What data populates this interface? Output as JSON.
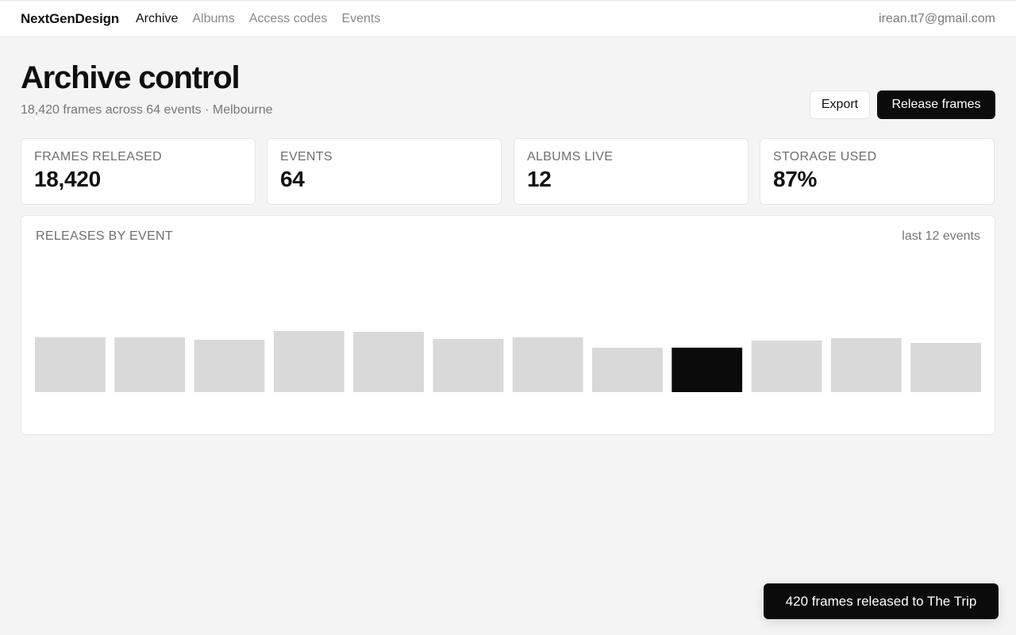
{
  "nav": {
    "brand": "NextGenDesign",
    "links": [
      {
        "label": "Archive",
        "active": true
      },
      {
        "label": "Albums",
        "active": false
      },
      {
        "label": "Access codes",
        "active": false
      },
      {
        "label": "Events",
        "active": false
      }
    ],
    "user_email": "irean.tt7@gmail.com"
  },
  "header": {
    "title": "Archive control",
    "subtitle": "18,420 frames across 64 events · Melbourne",
    "export_label": "Export",
    "release_label": "Release frames"
  },
  "stats": [
    {
      "label": "FRAMES RELEASED",
      "value": "18,420"
    },
    {
      "label": "EVENTS",
      "value": "64"
    },
    {
      "label": "ALBUMS LIVE",
      "value": "12"
    },
    {
      "label": "STORAGE USED",
      "value": "87%"
    }
  ],
  "chart": {
    "title": "RELEASES BY EVENT",
    "range_label": "last 12 events"
  },
  "chart_data": {
    "type": "bar",
    "title": "RELEASES BY EVENT",
    "values": [
      69,
      69,
      66,
      77,
      76,
      67,
      69,
      56,
      56,
      65,
      68,
      62
    ],
    "highlight_index": 8,
    "ylim": [
      0,
      170
    ],
    "grid": false,
    "legend": "none",
    "bar_color": "#d9d9d9",
    "highlight_color": "#0b0b0b"
  },
  "toast": {
    "message": "420 frames released to The Trip"
  },
  "colors": {
    "accent": "#0b0b0b",
    "background": "#f4f4f4",
    "card": "#ffffff"
  }
}
